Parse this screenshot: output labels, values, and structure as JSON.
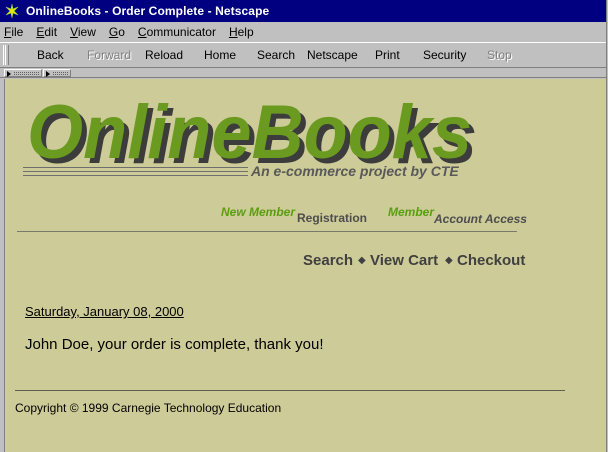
{
  "window": {
    "title": "OnlineBooks - Order Complete - Netscape",
    "app_icon": "netscape-icon"
  },
  "menu": [
    {
      "underline": "F",
      "rest": "ile"
    },
    {
      "underline": "E",
      "rest": "dit"
    },
    {
      "underline": "V",
      "rest": "iew"
    },
    {
      "underline": "G",
      "rest": "o"
    },
    {
      "underline": "C",
      "rest": "ommunicator"
    },
    {
      "underline": "H",
      "rest": "elp"
    }
  ],
  "toolbar": {
    "back": "Back",
    "forward": "Forward",
    "reload": "Reload",
    "home": "Home",
    "search": "Search",
    "netscape": "Netscape",
    "print": "Print",
    "security": "Security",
    "stop": "Stop"
  },
  "logo": {
    "text": "OnlineBooks",
    "tagline": "An e-commerce project by CTE",
    "colors": {
      "fill": "#6a9a1f",
      "shadow": "#3c3c3c"
    }
  },
  "member_links": {
    "new_member": "New Member",
    "registration": "Registration",
    "member": "Member",
    "account_access": "Account Access"
  },
  "nav": {
    "search": "Search",
    "view_cart": "View Cart",
    "checkout": "Checkout",
    "separator": "◆"
  },
  "order": {
    "date": "Saturday, January 08, 2000",
    "message": "John Doe, your order is complete, thank you!"
  },
  "footer": {
    "copyright": "Copyright © 1999 Carnegie Technology Education"
  },
  "colors": {
    "page_bg": "#cdcb98",
    "titlebar": "#000080",
    "accent_green": "#5a9e0f"
  }
}
